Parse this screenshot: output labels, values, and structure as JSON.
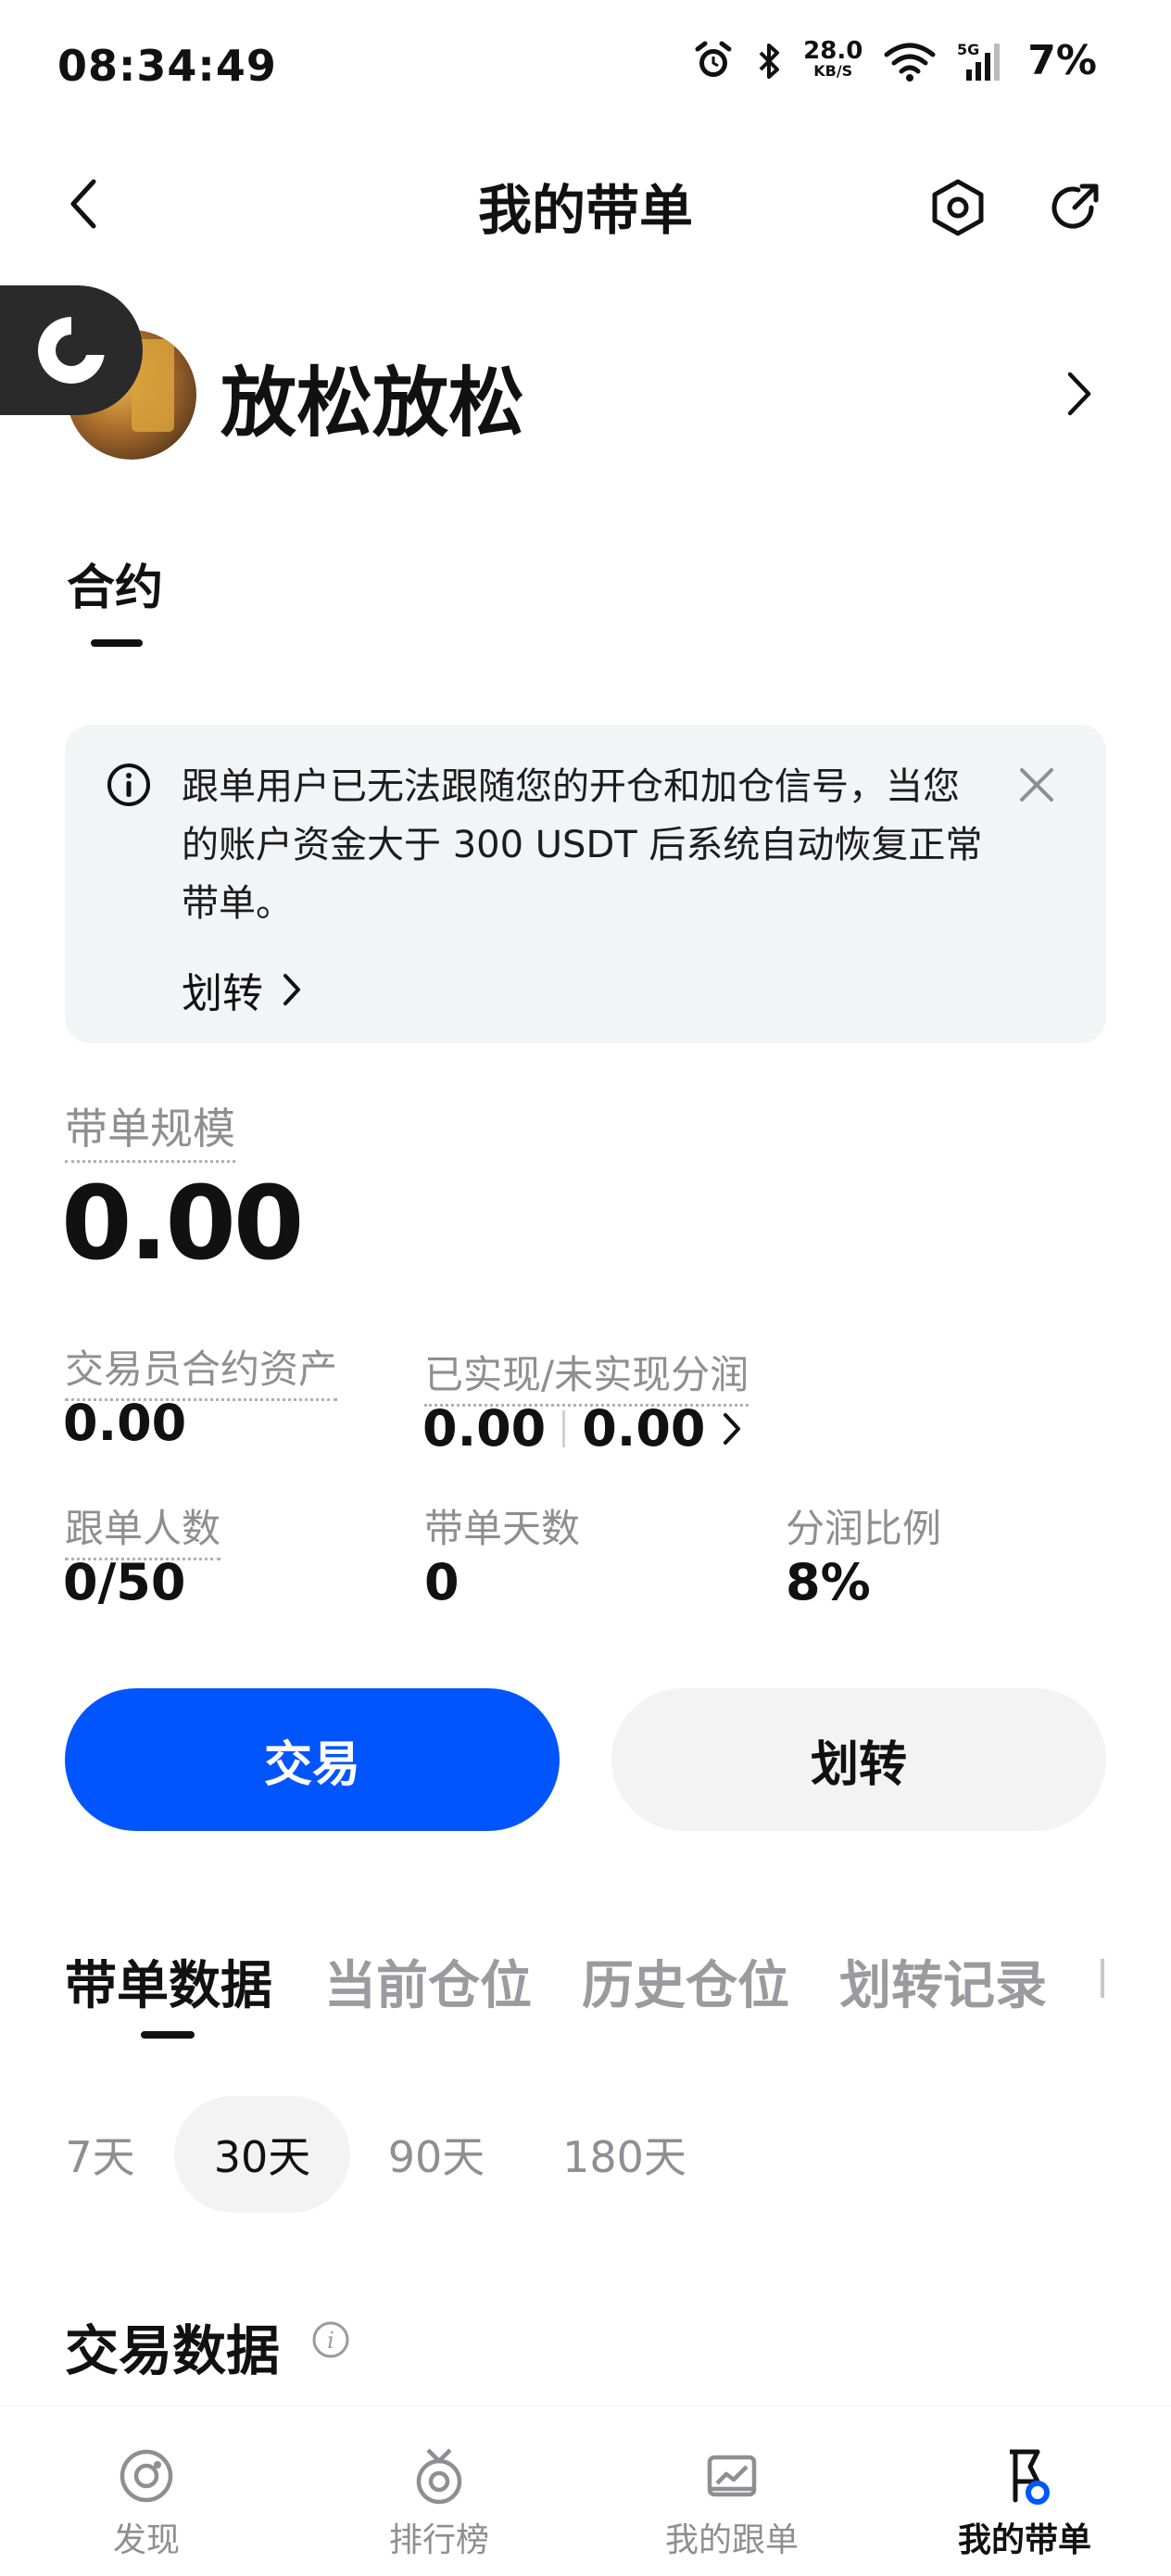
{
  "status_bar": {
    "time": "08:34:49",
    "net_speed": "28.0",
    "net_unit": "KB/S",
    "network": "5G",
    "battery": "7%"
  },
  "header": {
    "title": "我的带单",
    "back_icon": "chevron-left-icon",
    "settings_icon": "hexagon-settings-icon",
    "share_icon": "share-icon"
  },
  "profile": {
    "name": "放松放松"
  },
  "top_tabs": [
    {
      "label": "合约",
      "active": true
    }
  ],
  "notice": {
    "text": "跟单用户已无法跟随您的开仓和加仓信号，当您的账户资金大于 300 USDT 后系统自动恢复正常带单。",
    "link_label": "划转"
  },
  "stats": {
    "scale_label": "带单规模",
    "scale_value": "0.00",
    "trader_assets_label": "交易员合约资产",
    "trader_assets_value": "0.00",
    "profit_label": "已实现/未实现分润",
    "realized_value": "0.00",
    "unrealized_value": "0.00",
    "followers_label": "跟单人数",
    "followers_value": "0/50",
    "days_label": "带单天数",
    "days_value": "0",
    "share_label": "分润比例",
    "share_value": "8%"
  },
  "actions": {
    "trade_label": "交易",
    "transfer_label": "划转"
  },
  "sub_tabs": [
    {
      "label": "带单数据",
      "active": true
    },
    {
      "label": "当前仓位",
      "active": false
    },
    {
      "label": "历史仓位",
      "active": false
    },
    {
      "label": "划转记录",
      "active": false
    }
  ],
  "periods": [
    {
      "label": "7天",
      "active": false
    },
    {
      "label": "30天",
      "active": true
    },
    {
      "label": "90天",
      "active": false
    },
    {
      "label": "180天",
      "active": false
    }
  ],
  "section": {
    "title": "交易数据"
  },
  "bottom_nav": [
    {
      "label": "发现",
      "icon": "discover-icon",
      "active": false
    },
    {
      "label": "排行榜",
      "icon": "medal-icon",
      "active": false
    },
    {
      "label": "我的跟单",
      "icon": "chart-wallet-icon",
      "active": false
    },
    {
      "label": "我的带单",
      "icon": "trader-flag-icon",
      "active": true
    }
  ],
  "colors": {
    "primary": "#0055ff",
    "notice_bg": "#f3f4f6",
    "muted_text": "#8e8e93"
  }
}
